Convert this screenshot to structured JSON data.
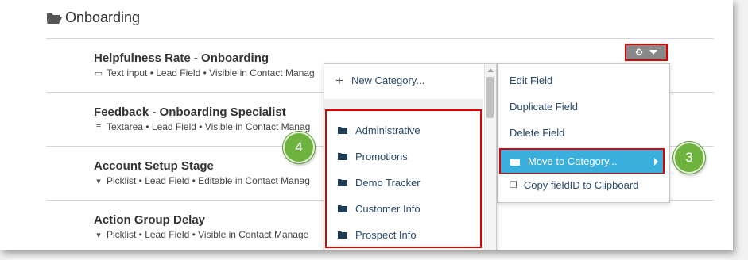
{
  "category": {
    "title": "Onboarding"
  },
  "fields": [
    {
      "title": "Helpfulness Rate - Onboarding",
      "type_icon": "text-input-icon",
      "meta": "Text input • Lead Field • Visible in Contact Manag"
    },
    {
      "title": "Feedback - Onboarding Specialist",
      "type_icon": "textarea-icon",
      "meta": "Textarea • Lead Field • Visible in Contact Manag"
    },
    {
      "title": "Account Setup Stage",
      "type_icon": "picklist-icon",
      "meta": "Picklist • Lead Field • Editable in Contact Manag"
    },
    {
      "title": "Action Group Delay",
      "type_icon": "picklist-icon",
      "meta": "Picklist • Lead Field • Visible in Contact Manage"
    }
  ],
  "actions_menu": {
    "items": [
      {
        "label": "Edit Field"
      },
      {
        "label": "Duplicate Field"
      },
      {
        "label": "Delete Field"
      },
      {
        "label": "Move to Category...",
        "active": true
      },
      {
        "label": "Copy fieldID to Clipboard"
      }
    ]
  },
  "category_submenu": {
    "new_label": "New Category...",
    "items": [
      "Administrative",
      "Promotions",
      "Demo Tracker",
      "Customer Info",
      "Prospect Info"
    ]
  },
  "callouts": {
    "left": "4",
    "right": "3"
  },
  "colors": {
    "highlight": "#e00000",
    "active_item": "#3aaedc",
    "callout": "#6fb33f",
    "link_text": "#2a4a6a"
  }
}
